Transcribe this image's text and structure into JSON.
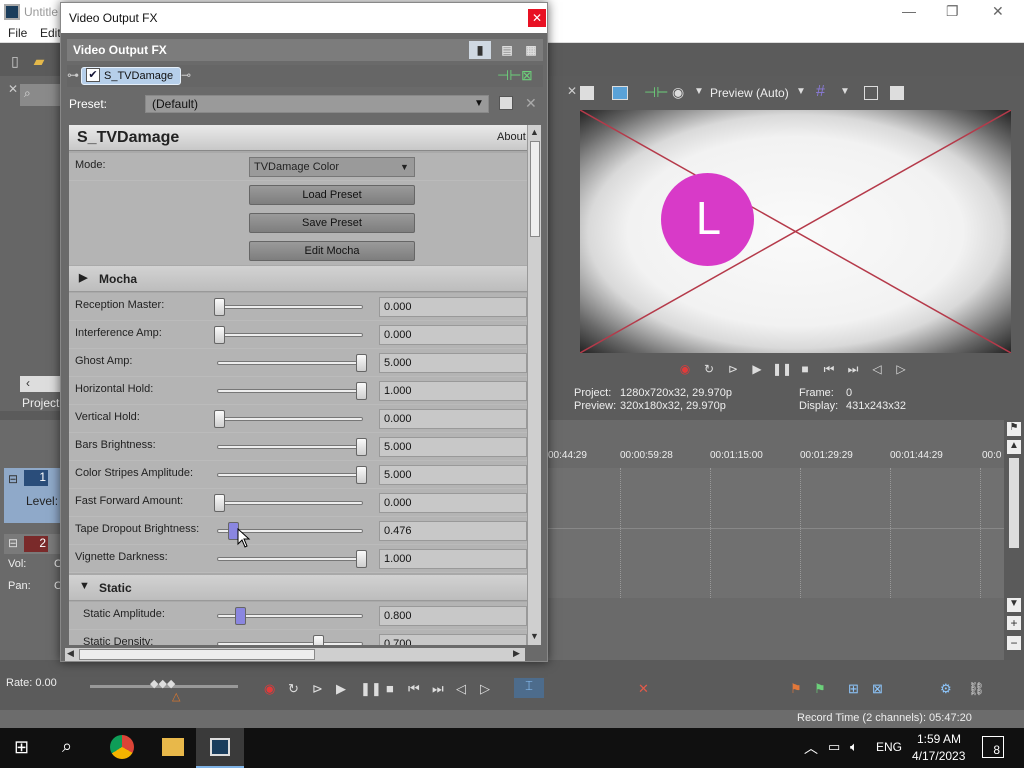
{
  "app": {
    "title": "Untitle",
    "menu": [
      "File",
      "Edit"
    ],
    "explorer_tab": "Project",
    "window_buttons": [
      "—",
      "❐",
      "✕"
    ]
  },
  "fx_dialog": {
    "title": "Video Output FX",
    "close": "✕",
    "header": "Video Output FX",
    "chain_item": "S_TVDamage",
    "preset_label": "Preset:",
    "preset_value": "(Default)",
    "plugin_title": "S_TVDamage",
    "about": "About",
    "mode_label": "Mode:",
    "mode_value": "TVDamage Color",
    "buttons": [
      "Load Preset",
      "Save Preset",
      "Edit Mocha"
    ],
    "mocha_section": "Mocha",
    "static_section": "Static",
    "params": [
      {
        "label": "Reception Master:",
        "value": "0.000",
        "level": 0.0
      },
      {
        "label": "Interference Amp:",
        "value": "0.000",
        "level": 0.0
      },
      {
        "label": "Ghost Amp:",
        "value": "5.000",
        "level": 1.0
      },
      {
        "label": "Horizontal Hold:",
        "value": "1.000",
        "level": 1.0
      },
      {
        "label": "Vertical Hold:",
        "value": "0.000",
        "level": 0.0
      },
      {
        "label": "Bars Brightness:",
        "value": "5.000",
        "level": 1.0
      },
      {
        "label": "Color Stripes Amplitude:",
        "value": "5.000",
        "level": 1.0
      },
      {
        "label": "Fast Forward Amount:",
        "value": "0.000",
        "level": 0.0
      },
      {
        "label": "Tape Dropout Brightness:",
        "value": "0.476",
        "level": 0.1
      },
      {
        "label": "Vignette Darkness:",
        "value": "1.000",
        "level": 1.0
      }
    ],
    "static_params": [
      {
        "label": "Static Amplitude:",
        "value": "0.800",
        "level": 0.15
      },
      {
        "label": "Static Density:",
        "value": "0.700",
        "level": 0.7
      }
    ]
  },
  "preview": {
    "mode": "Preview (Auto)",
    "frame_letter": "L",
    "project_label": "Project:",
    "project_value": "1280x720x32, 29.970p",
    "preview_label": "Preview:",
    "preview_value": "320x180x32, 29.970p",
    "frame_label": "Frame:",
    "frame_value": "0",
    "display_label": "Display:",
    "display_value": "431x243x32"
  },
  "timeline": {
    "ruler": [
      "00:44:29",
      "00:00:59:28",
      "00:01:15:00",
      "00:01:29:29",
      "00:01:44:29",
      "00:0"
    ],
    "track1_label": "Level:",
    "track1_num": "1",
    "track2_num": "2",
    "vol_label": "Vol:",
    "pan_label": "Pan:",
    "vol_trunc": "C",
    "pan_trunc": "C",
    "rate": "Rate: 0.00",
    "record_time": "Record Time (2 channels): 05:47:20"
  },
  "taskbar": {
    "lang": "ENG",
    "time": "1:59 AM",
    "date": "4/17/2023",
    "notif_count": "8"
  },
  "colors": {
    "accent_circle": "#d83ac8",
    "chip": "#b6cfea",
    "close_red": "#e81123"
  }
}
